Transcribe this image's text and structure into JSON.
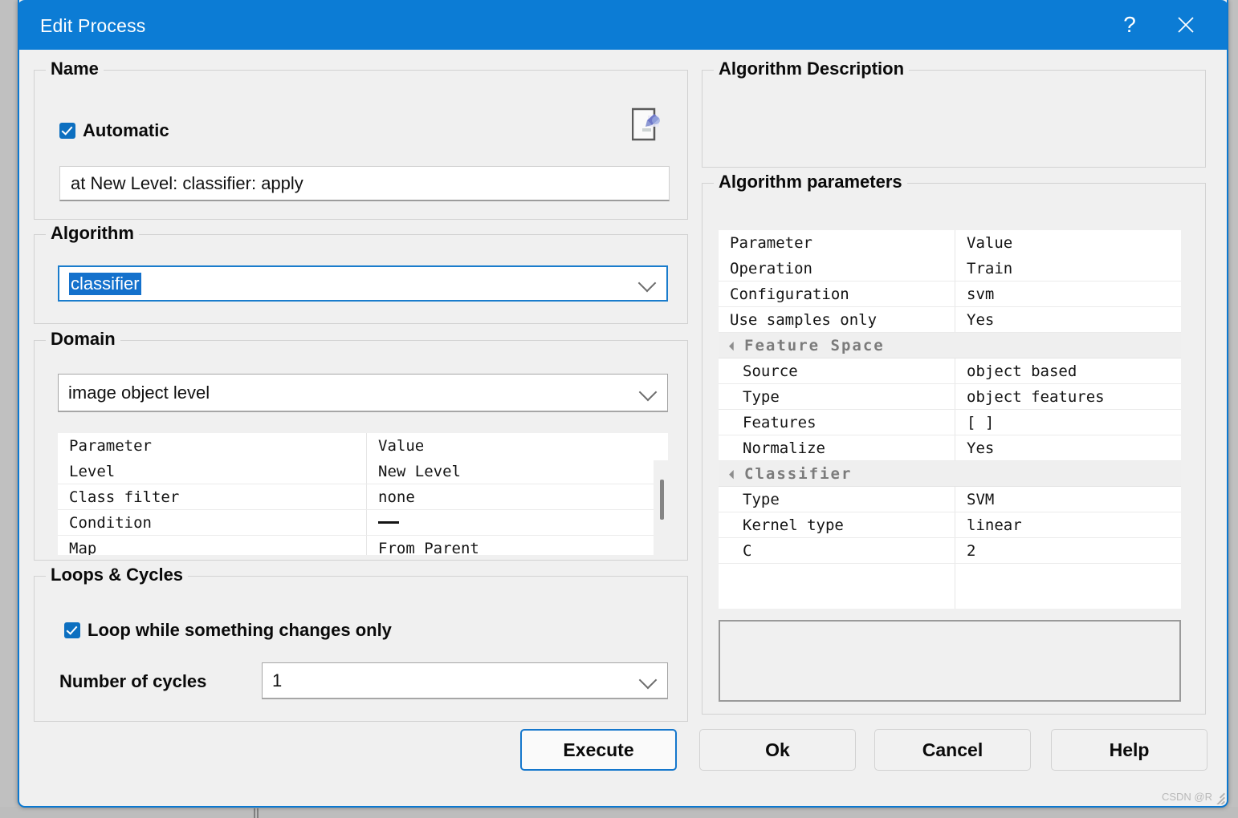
{
  "window": {
    "title": "Edit Process",
    "help_icon": "question-mark-icon",
    "close_icon": "close-x-icon",
    "accent_color": "#0c7cd5",
    "watermark": "CSDN @R"
  },
  "name_group": {
    "legend": "Name",
    "automatic_checkbox": {
      "label": "Automatic",
      "checked": true
    },
    "edit_icon": "document-edit-icon",
    "name_field": {
      "value": "at  New Level: classifier: apply",
      "placeholder": ""
    }
  },
  "algorithm_group": {
    "legend": "Algorithm",
    "combo": {
      "value": "classifier",
      "selected": true,
      "chevron_icon": "chevron-down-icon"
    }
  },
  "domain_group": {
    "legend": "Domain",
    "combo": {
      "value": "image object level",
      "chevron_icon": "chevron-down-icon"
    },
    "table": {
      "columns": [
        "Parameter",
        "Value"
      ],
      "rows": [
        {
          "parameter": "Level",
          "value": "New Level",
          "kind": "item"
        },
        {
          "parameter": "Class filter",
          "value": "none",
          "kind": "item"
        },
        {
          "parameter": "Condition",
          "value": "—",
          "kind": "item"
        },
        {
          "parameter": "Map",
          "value": "From Parent",
          "kind": "item"
        }
      ]
    }
  },
  "loops_group": {
    "legend": "Loops & Cycles",
    "loop_checkbox": {
      "label": "Loop while something changes only",
      "checked": true
    },
    "cycles_label": "Number of cycles",
    "cycles_combo": {
      "value": "1",
      "chevron_icon": "chevron-down-icon"
    }
  },
  "algorithm_description": {
    "legend": "Algorithm Description",
    "text": ""
  },
  "algorithm_parameters": {
    "legend": "Algorithm parameters",
    "table": {
      "columns": [
        "Parameter",
        "Value"
      ],
      "rows": [
        {
          "parameter": "Operation",
          "value": "Train",
          "kind": "item"
        },
        {
          "parameter": "Configuration",
          "value": "svm",
          "kind": "item"
        },
        {
          "parameter": "Use samples only",
          "value": "Yes",
          "kind": "item"
        },
        {
          "parameter": "Feature Space",
          "value": "",
          "kind": "group"
        },
        {
          "parameter": "Source",
          "value": "object based",
          "kind": "child"
        },
        {
          "parameter": "Type",
          "value": "object features",
          "kind": "child"
        },
        {
          "parameter": "Features",
          "value": "[  ]",
          "kind": "child"
        },
        {
          "parameter": "Normalize",
          "value": "Yes",
          "kind": "child"
        },
        {
          "parameter": "Classifier",
          "value": "",
          "kind": "group"
        },
        {
          "parameter": "Type",
          "value": "SVM",
          "kind": "child"
        },
        {
          "parameter": "Kernel type",
          "value": "linear",
          "kind": "child"
        },
        {
          "parameter": "C",
          "value": "2",
          "kind": "child"
        }
      ]
    },
    "detail_box_text": ""
  },
  "buttons": {
    "execute": "Execute",
    "ok": "Ok",
    "cancel": "Cancel",
    "help": "Help"
  }
}
